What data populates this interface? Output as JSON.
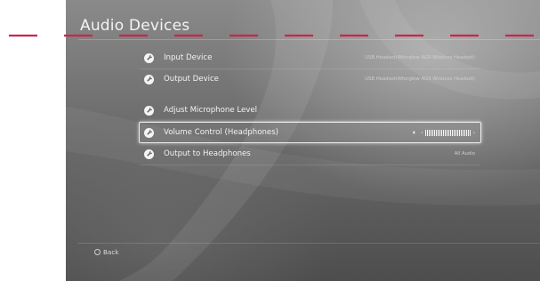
{
  "page": {
    "title": "Audio Devices",
    "back_label": "Back"
  },
  "colors": {
    "dash_accent": "#d0234a",
    "text_primary": "#f2f2f2",
    "text_secondary": "#cfcfcf"
  },
  "menu": {
    "items": [
      {
        "label": "Input Device",
        "value": "USB Headset(Afterglow AG9 Wireless Headset)",
        "icon": "wrench-icon"
      },
      {
        "label": "Output Device",
        "value": "USB Headset(Afterglow AG9 Wireless Headset)",
        "icon": "wrench-icon"
      },
      {
        "label": "Adjust Microphone Level",
        "value": "",
        "icon": "wrench-icon"
      },
      {
        "label": "Volume Control (Headphones)",
        "value": "",
        "icon": "wrench-icon",
        "selected": true,
        "volume_level_of_max": "max (all bars filled)"
      },
      {
        "label": "Output to Headphones",
        "value": "All Audio",
        "icon": "wrench-icon"
      }
    ]
  },
  "volume": {
    "speaker_icon": "speaker-icon",
    "glyph_left": "‹",
    "glyph_right": "›",
    "bars_filled": 26,
    "bars_total": 26
  }
}
